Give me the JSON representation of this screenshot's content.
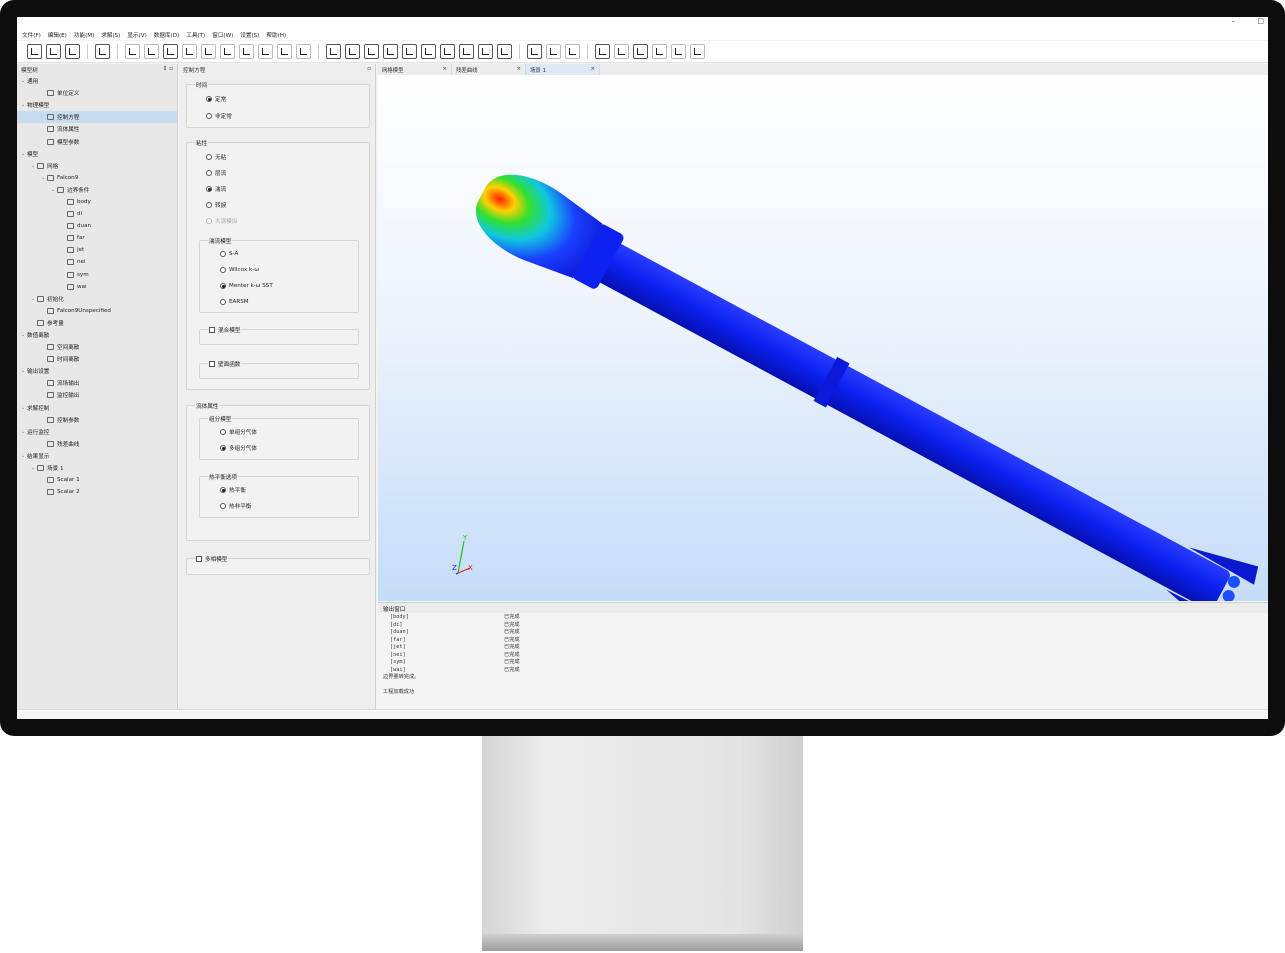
{
  "menu": [
    "文件(F)",
    "编辑(E)",
    "功能(M)",
    "求解(S)",
    "显示(V)",
    "数据库(D)",
    "工具(T)",
    "窗口(W)",
    "设置(S)",
    "帮助(H)"
  ],
  "window_controls": [
    "–",
    "□"
  ],
  "tree": {
    "title": "模型树",
    "items": [
      {
        "label": "通用",
        "indent": 0,
        "arrow": "v",
        "icon": false
      },
      {
        "label": "单位定义",
        "indent": 2,
        "arrow": "",
        "icon": true
      },
      {
        "label": "物理模型",
        "indent": 0,
        "arrow": "v",
        "icon": false
      },
      {
        "label": "控制方程",
        "indent": 2,
        "arrow": "",
        "icon": true,
        "selected": true
      },
      {
        "label": "流体属性",
        "indent": 2,
        "arrow": "",
        "icon": true
      },
      {
        "label": "模型参数",
        "indent": 2,
        "arrow": "",
        "icon": true
      },
      {
        "label": "模型",
        "indent": 0,
        "arrow": "v",
        "icon": false
      },
      {
        "label": "网格",
        "indent": 1,
        "arrow": "v",
        "icon": true
      },
      {
        "label": "Falcon9",
        "indent": 2,
        "arrow": "v",
        "icon": true
      },
      {
        "label": "边界条件",
        "indent": 3,
        "arrow": "v",
        "icon": true
      },
      {
        "label": "body",
        "indent": 4,
        "arrow": "",
        "icon": true
      },
      {
        "label": "di",
        "indent": 4,
        "arrow": "",
        "icon": true
      },
      {
        "label": "duan",
        "indent": 4,
        "arrow": "",
        "icon": true
      },
      {
        "label": "far",
        "indent": 4,
        "arrow": "",
        "icon": true
      },
      {
        "label": "jet",
        "indent": 4,
        "arrow": "",
        "icon": true
      },
      {
        "label": "nei",
        "indent": 4,
        "arrow": "",
        "icon": true
      },
      {
        "label": "sym",
        "indent": 4,
        "arrow": "",
        "icon": true
      },
      {
        "label": "wai",
        "indent": 4,
        "arrow": "",
        "icon": true
      },
      {
        "label": "初始化",
        "indent": 1,
        "arrow": "v",
        "icon": true
      },
      {
        "label": "Falcon9Unspecified",
        "indent": 2,
        "arrow": "",
        "icon": true
      },
      {
        "label": "参考量",
        "indent": 1,
        "arrow": "",
        "icon": true
      },
      {
        "label": "数值离散",
        "indent": 0,
        "arrow": "v",
        "icon": false
      },
      {
        "label": "空间离散",
        "indent": 2,
        "arrow": "",
        "icon": true
      },
      {
        "label": "时间离散",
        "indent": 2,
        "arrow": "",
        "icon": true
      },
      {
        "label": "输出设置",
        "indent": 0,
        "arrow": "v",
        "icon": false
      },
      {
        "label": "流场输出",
        "indent": 2,
        "arrow": "",
        "icon": true
      },
      {
        "label": "监控输出",
        "indent": 2,
        "arrow": "",
        "icon": true
      },
      {
        "label": "求解控制",
        "indent": 0,
        "arrow": "v",
        "icon": false
      },
      {
        "label": "控制参数",
        "indent": 2,
        "arrow": "",
        "icon": true
      },
      {
        "label": "运行监控",
        "indent": 0,
        "arrow": "v",
        "icon": false
      },
      {
        "label": "残差曲线",
        "indent": 2,
        "arrow": "",
        "icon": true
      },
      {
        "label": "结果显示",
        "indent": 0,
        "arrow": "v",
        "icon": false
      },
      {
        "label": "场景 1",
        "indent": 1,
        "arrow": "v",
        "icon": true
      },
      {
        "label": "Scalar 1",
        "indent": 2,
        "arrow": "",
        "icon": true
      },
      {
        "label": "Scalar 2",
        "indent": 2,
        "arrow": "",
        "icon": true
      }
    ]
  },
  "control": {
    "title": "控制方程",
    "time": {
      "title": "时间",
      "steady": "定常",
      "unsteady": "非定常"
    },
    "viscous": {
      "title": "粘性",
      "inviscid": "无粘",
      "laminar": "层流",
      "turbulent": "湍流",
      "transition": "转捩",
      "les": "大涡模拟"
    },
    "turb_model": {
      "title": "湍流模型",
      "sa": "S-A",
      "wilcox": "Wilcox k-ω",
      "sst": "Menter k-ω SST",
      "earsm": "EARSM"
    },
    "hybrid": "混合模型",
    "wall_func": "壁面函数",
    "fluid": {
      "title": "流体属性",
      "component": "组分模型",
      "single": "单组分气体",
      "multi": "多组分气体",
      "thermo": "热平衡选项",
      "equil": "热平衡",
      "nonequil": "热非平衡"
    },
    "multiphase": "多相模型"
  },
  "tabs": [
    {
      "label": "网格模型",
      "close": "×"
    },
    {
      "label": "残差曲线",
      "close": "×"
    },
    {
      "label": "场景 1",
      "close": "×",
      "active": true
    }
  ],
  "axes": {
    "y": "Y",
    "z": "Z",
    "x": "X"
  },
  "output": {
    "title": "输出窗口",
    "rows": [
      {
        "name": "[body]",
        "status": "已完成"
      },
      {
        "name": "[di]",
        "status": "已完成"
      },
      {
        "name": "[duan]",
        "status": "已完成"
      },
      {
        "name": "[far]",
        "status": "已完成"
      },
      {
        "name": "[jet]",
        "status": "已完成"
      },
      {
        "name": "[nei]",
        "status": "已完成"
      },
      {
        "name": "[sym]",
        "status": "已完成"
      },
      {
        "name": "[wai]",
        "status": "已完成"
      }
    ],
    "line1": "边界量转完成。",
    "line2": "工程加载成功"
  }
}
